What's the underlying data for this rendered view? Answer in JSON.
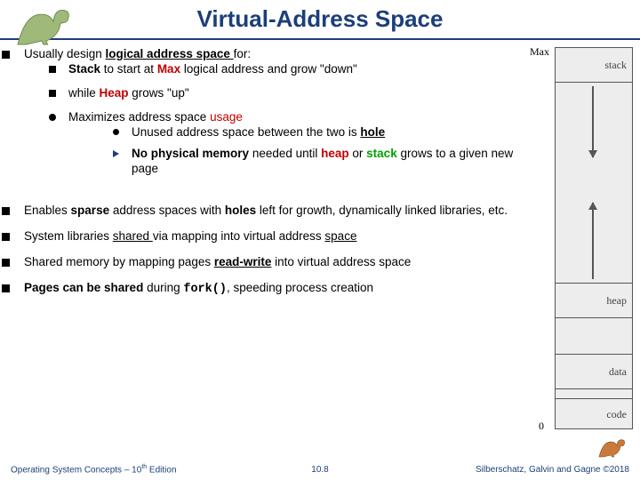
{
  "title": "Virtual-Address Space",
  "bullets": {
    "p1": {
      "text": "Usually design <b><u>logical address space </u></b>for:",
      "sub": {
        "a": " <b>Stack</b> to start at <b><span style='color:#c00000'>Max</span></b> logical address and grow \"down\"",
        "b": "while <b><span style='color:#c00000'>Heap</span></b> grows \"up\"",
        "c": {
          "text": "Maximizes address space <span style='color:#c00000'>usage</span>",
          "sub": {
            "i": "Unused address space between the two is <b><u>hole</u></b>",
            "ii": "<b>No physical memory </b>needed until <b><span style='color:#c00000'>heap</span></b> or <b><span style='color:#00a000'>stack</span></b> grows to a given new page"
          }
        }
      }
    },
    "p2": "Enables <b>sparse</b> address spaces with <b>holes</b> left for growth, dynamically linked libraries, etc.",
    "p3": "System libraries <u>shared </u>via mapping into virtual address <u>space</u>",
    "p4": "Shared memory by mapping pages <b><u>read-write</u></b> into virtual address space",
    "p5": "<b>Pages can be shared </b>during <span class='mono'><b>fork()</b></span>, speeding process creation"
  },
  "figure": {
    "max": "Max",
    "zero": "0",
    "stack": "stack",
    "heap": "heap",
    "data": "data",
    "code": "code"
  },
  "footer": {
    "left": "Operating System Concepts – 10<sup>th</sup> Edition",
    "center": "10.8",
    "right": "Silberschatz, Galvin and Gagne ©2018"
  }
}
